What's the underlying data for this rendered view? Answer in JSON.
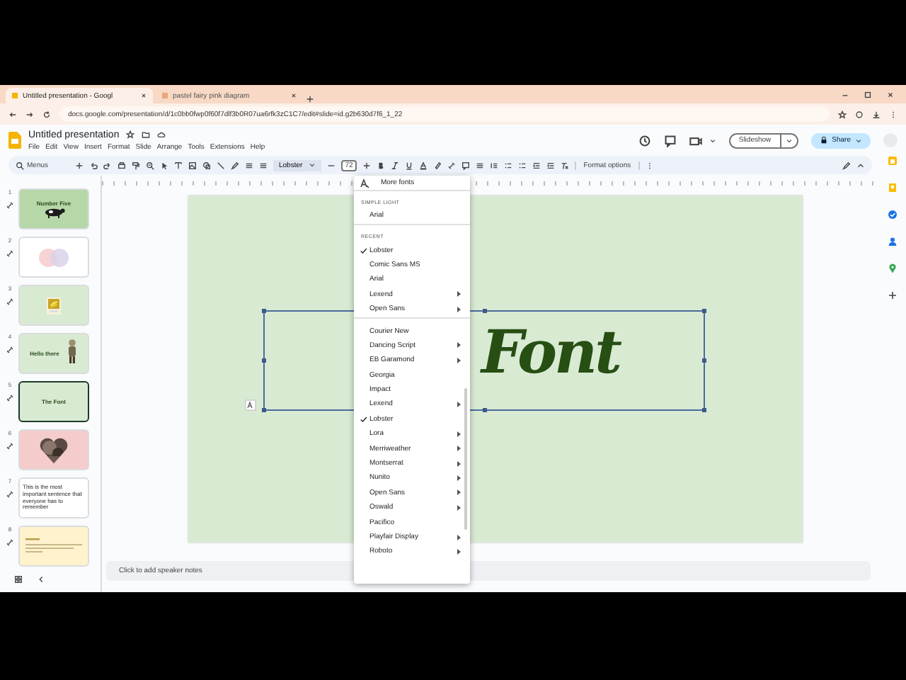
{
  "browser": {
    "tabs": [
      {
        "title": "Untitled presentation - Googl",
        "selected": true
      },
      {
        "title": "pastel fairy pink diagram",
        "selected": false
      }
    ],
    "url": "docs.google.com/presentation/d/1c0bb0fwp0f60f7dlf3b0R07ua6rfk3zC1C7/edit#slide=id.g2b630d7f6_1_22"
  },
  "document": {
    "title": "Untitled presentation",
    "menu": [
      "File",
      "Edit",
      "View",
      "Insert",
      "Format",
      "Slide",
      "Arrange",
      "Tools",
      "Extensions",
      "Help"
    ],
    "slideshow": "Slideshow",
    "share": "Share"
  },
  "toolbar": {
    "search": "Menus",
    "font": "Lobster",
    "font_size": "72",
    "format_options": "Format options"
  },
  "filmstrip": [
    {
      "number": "1",
      "kind": "cow",
      "text": "Number Five",
      "color": "#b6d7a8",
      "selected": false
    },
    {
      "number": "2",
      "kind": "venn",
      "color": "#ffffff",
      "selected": false
    },
    {
      "number": "3",
      "color": "#d9ead3",
      "selected": false
    },
    {
      "number": "4",
      "kind": "figure",
      "text": "Hello there",
      "color": "#d9ead3",
      "selected": false
    },
    {
      "number": "5",
      "kind": "title",
      "text": "The Font",
      "color": "#d9ead3",
      "selected": true
    },
    {
      "number": "6",
      "kind": "heart",
      "color": "#f4cccc",
      "selected": false
    },
    {
      "number": "7",
      "kind": "paragraph",
      "text": "This is the most important sentence that everyone has to remember",
      "color": "#ffffff",
      "selected": false
    },
    {
      "number": "8",
      "kind": "note",
      "color": "#fff2cc",
      "selected": false
    }
  ],
  "slide": {
    "text": "Font",
    "color": "#d9ead3"
  },
  "font_menu": {
    "more_fonts": "More fonts",
    "sections": [
      {
        "heading": "SIMPLE LIGHT",
        "items": [
          {
            "name": "Arial",
            "checked": false,
            "submenu": false
          }
        ]
      },
      {
        "heading": "RECENT",
        "items": [
          {
            "name": "Lobster",
            "checked": true,
            "submenu": false
          },
          {
            "name": "Comic Sans MS",
            "checked": false,
            "submenu": false
          },
          {
            "name": "Arial",
            "checked": false,
            "submenu": false
          },
          {
            "name": "Lexend",
            "checked": false,
            "submenu": true
          },
          {
            "name": "Open Sans",
            "checked": false,
            "submenu": true
          }
        ]
      },
      {
        "items": [
          {
            "name": "Courier New",
            "checked": false,
            "submenu": false
          },
          {
            "name": "Dancing Script",
            "checked": false,
            "submenu": true
          },
          {
            "name": "EB Garamond",
            "checked": false,
            "submenu": true
          },
          {
            "name": "Georgia",
            "checked": false,
            "submenu": false
          },
          {
            "name": "Impact",
            "checked": false,
            "submenu": false
          },
          {
            "name": "Lexend",
            "checked": false,
            "submenu": true
          },
          {
            "name": "Lobster",
            "checked": true,
            "submenu": false
          },
          {
            "name": "Lora",
            "checked": false,
            "submenu": true
          },
          {
            "name": "Merriweather",
            "checked": false,
            "submenu": true
          },
          {
            "name": "Montserrat",
            "checked": false,
            "submenu": true
          },
          {
            "name": "Nunito",
            "checked": false,
            "submenu": true
          },
          {
            "name": "Open Sans",
            "checked": false,
            "submenu": true
          },
          {
            "name": "Oswald",
            "checked": false,
            "submenu": true
          },
          {
            "name": "Pacifico",
            "checked": false,
            "submenu": false
          },
          {
            "name": "Playfair Display",
            "checked": false,
            "submenu": true
          },
          {
            "name": "Roboto",
            "checked": false,
            "submenu": true
          }
        ]
      }
    ]
  },
  "speaker_notes": {
    "placeholder": "Click to add speaker notes"
  }
}
